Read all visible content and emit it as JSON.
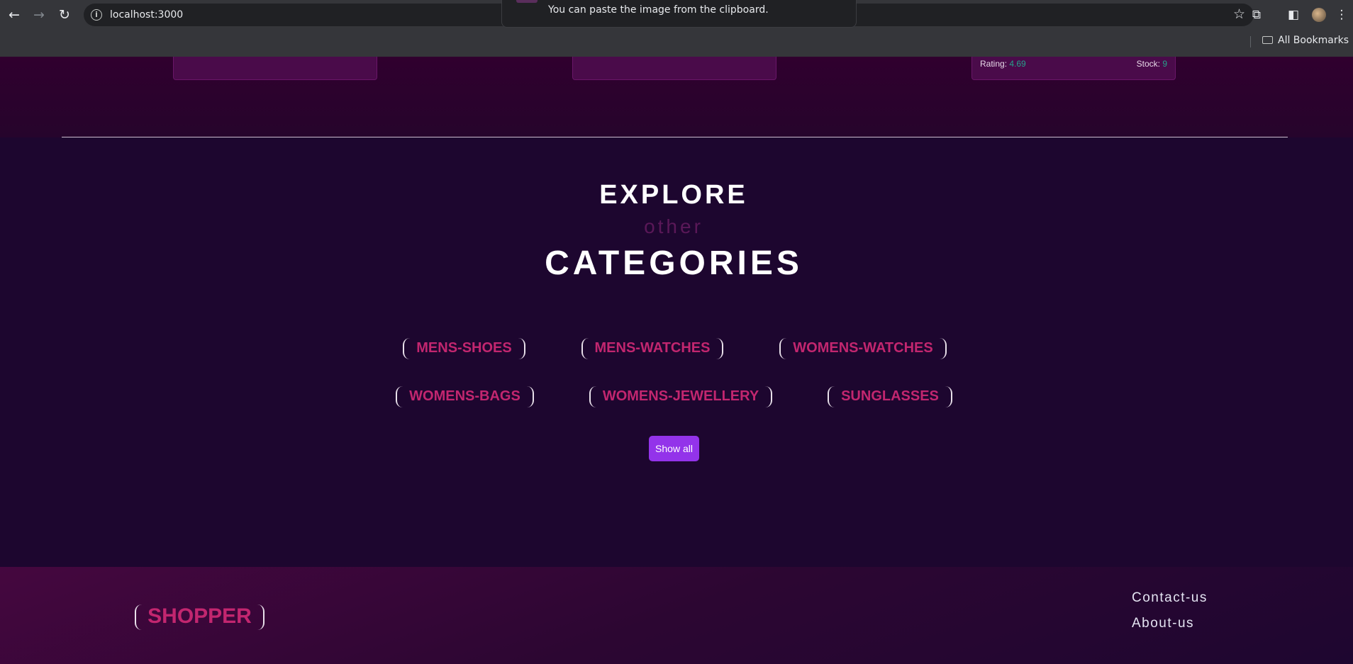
{
  "browser": {
    "url": "localhost:3000",
    "toast_message": "You can paste the image from the clipboard.",
    "bookmarks_label": "All Bookmarks",
    "icons": [
      "back-icon",
      "forward-icon",
      "reload-icon",
      "info-icon",
      "star-icon",
      "extensions-icon",
      "sidepanel-icon",
      "menu-icon"
    ]
  },
  "product_card": {
    "rating_label": "Rating:",
    "rating_value": "4.69",
    "stock_label": "Stock:",
    "stock_value": "9"
  },
  "explore": {
    "line1": "EXPLORE",
    "line2": "other",
    "line3": "CATEGORIES",
    "categories": [
      "MENS-SHOES",
      "MENS-WATCHES",
      "WOMENS-WATCHES",
      "WOMENS-BAGS",
      "WOMENS-JEWELLERY",
      "SUNGLASSES"
    ],
    "show_all_label": "Show all"
  },
  "footer": {
    "brand": "SHOPPER",
    "links": [
      "Contact-us",
      "About-us"
    ]
  },
  "colors": {
    "accent": "#c2266f",
    "button": "#9333ea",
    "background": "#1d062f",
    "stat_value": "#26a28a"
  }
}
